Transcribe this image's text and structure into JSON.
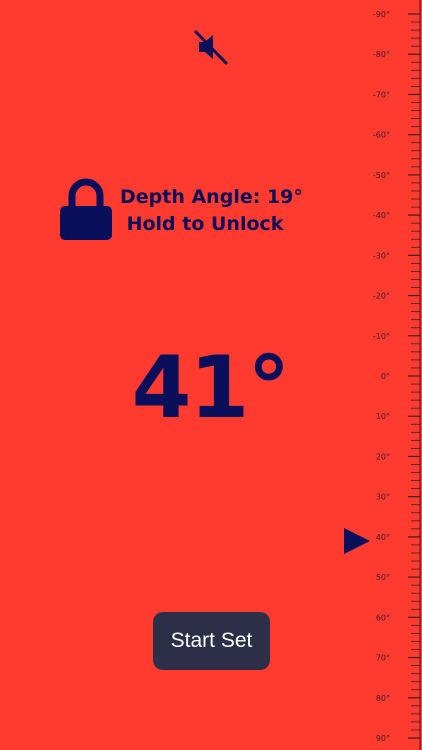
{
  "colors": {
    "background": "#FF3B30",
    "foreground": "#0A0F5C",
    "button_bg": "#2C2F47",
    "button_text": "#FFFFFF",
    "ruler_ink": "#3A1E2E"
  },
  "icons": {
    "mute": "speaker-muted-icon",
    "lock": "lock-icon",
    "indicator": "triangle-right-icon"
  },
  "status": {
    "depth_angle": "Depth Angle: 19°",
    "hint": "Hold to Unlock"
  },
  "readout": {
    "angle": "41°"
  },
  "ruler": {
    "labels": [
      "-90°",
      "-80°",
      "-70°",
      "-60°",
      "-50°",
      "-40°",
      "-30°",
      "-20°",
      "-10°",
      "0°",
      "10°",
      "20°",
      "30°",
      "40°",
      "50°",
      "60°",
      "70°",
      "80°",
      "90°"
    ],
    "min_degrees": -90,
    "max_degrees": 90,
    "indicator_degrees": 41
  },
  "actions": {
    "start_label": "Start Set"
  }
}
